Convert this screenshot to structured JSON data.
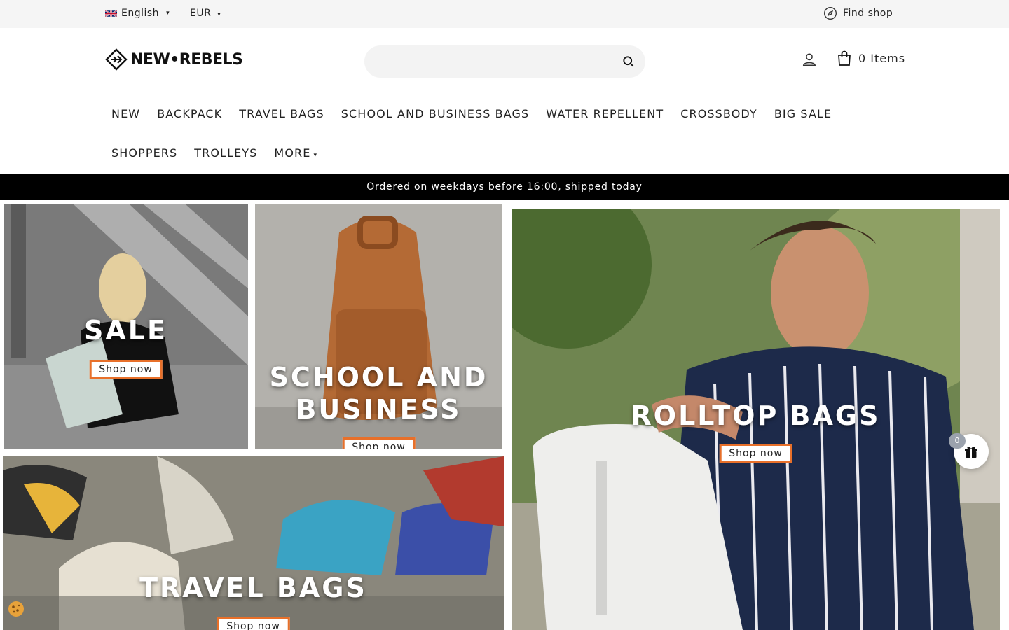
{
  "topbar": {
    "language": "English",
    "currency": "EUR",
    "find_shop": "Find shop",
    "caret": "▾"
  },
  "header": {
    "logo_text": "NEW•REBELS",
    "search_placeholder": "",
    "cart_label": "0 Items"
  },
  "nav": {
    "row1": [
      "NEW",
      "BACKPACK",
      "TRAVEL BAGS",
      "SCHOOL AND BUSINESS BAGS",
      "WATER REPELLENT",
      "CROSSBODY",
      "BIG SALE"
    ],
    "row2": [
      "SHOPPERS",
      "TROLLEYS"
    ],
    "more": "MORE"
  },
  "promo": {
    "text": "Ordered on weekdays before 16:00, shipped today"
  },
  "tiles": {
    "sale": {
      "title": "SALE",
      "button": "Shop now"
    },
    "school": {
      "title_line1": "SCHOOL AND",
      "title_line2": "BUSINESS",
      "button": "Shop now"
    },
    "travel": {
      "title": "TRAVEL BAGS",
      "button": "Shop now"
    },
    "rolltop": {
      "title": "ROLLTOP BAGS",
      "button": "Shop now"
    }
  },
  "widgets": {
    "gift_count": "0"
  },
  "colors": {
    "accent": "#e8702a",
    "promo_bg": "#000000",
    "topbar_bg": "#f5f5f5"
  }
}
